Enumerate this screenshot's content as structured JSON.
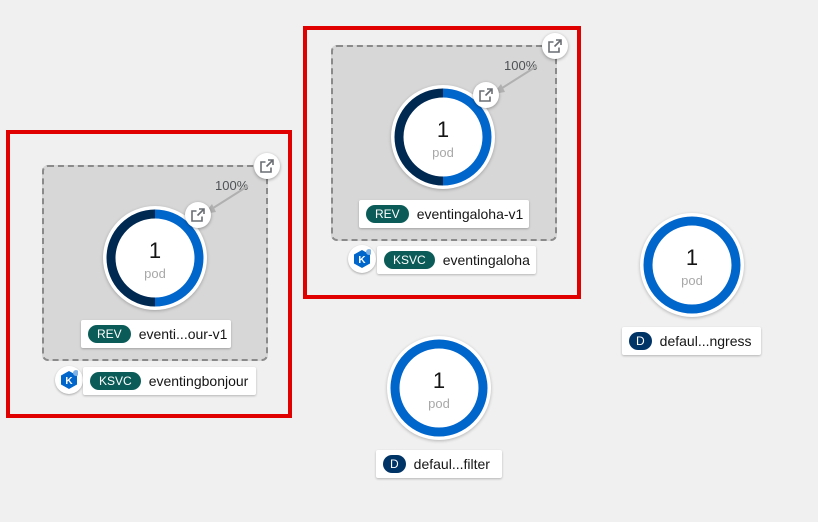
{
  "colors": {
    "highlight": "#e00000",
    "ring_blue": "#0066cc",
    "ring_dark": "#002952",
    "badge_teal": "#0b5c58",
    "badge_navy": "#003366"
  },
  "services": [
    {
      "name": "eventingbonjour",
      "badge": "KSVC",
      "revision": {
        "badge": "REV",
        "name": "eventi...our-v1",
        "traffic": "100%",
        "pods": "1",
        "pod_label": "pod"
      }
    },
    {
      "name": "eventingaloha",
      "badge": "KSVC",
      "revision": {
        "badge": "REV",
        "name": "eventingaloha-v1",
        "traffic": "100%",
        "pods": "1",
        "pod_label": "pod"
      }
    }
  ],
  "deployments": [
    {
      "badge": "D",
      "name": "defaul...ngress",
      "pods": "1",
      "pod_label": "pod"
    },
    {
      "badge": "D",
      "name": "defaul...filter",
      "pods": "1",
      "pod_label": "pod"
    }
  ],
  "icons": {
    "open_url": "external-link-icon",
    "knative": "knative-service-icon"
  }
}
